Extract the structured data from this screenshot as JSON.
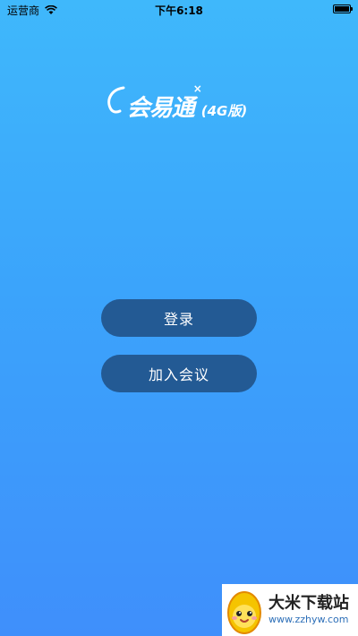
{
  "status_bar": {
    "carrier": "运营商",
    "time": "下午6:18",
    "icons": [
      "wifi-icon",
      "battery-icon"
    ]
  },
  "logo": {
    "name": "会易通",
    "suffix": "(4G版)"
  },
  "buttons": {
    "login": "登录",
    "join_meeting": "加入会议"
  },
  "watermark": {
    "title": "大米下载站",
    "url": "www.zzhyw.com"
  },
  "colors": {
    "background_top": "#3fb8fb",
    "background_bottom": "#3f8ffb",
    "button": "#235a94"
  }
}
